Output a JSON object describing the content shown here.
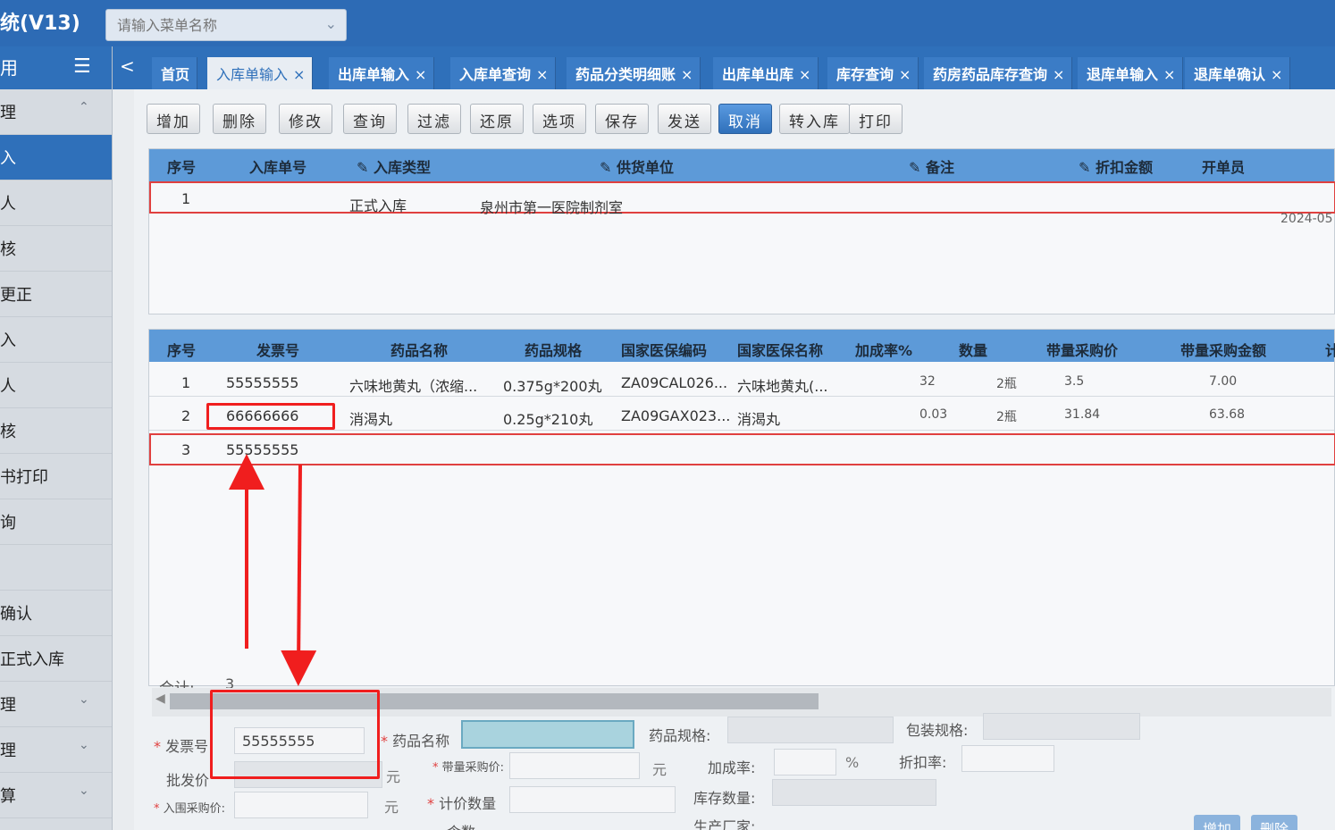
{
  "app": {
    "title": "统(V13)",
    "menu_search_placeholder": "请输入菜单名称"
  },
  "sidebar": {
    "header_label": "用",
    "items": [
      {
        "label": "理",
        "caret": "^",
        "active": false
      },
      {
        "label": "入",
        "active": true
      },
      {
        "label": "人",
        "active": false
      },
      {
        "label": "核",
        "active": false
      },
      {
        "label": "更正",
        "active": false
      },
      {
        "label": "入",
        "active": false
      },
      {
        "label": "人",
        "active": false
      },
      {
        "label": "核",
        "active": false
      },
      {
        "label": "书打印",
        "active": false
      },
      {
        "label": "询",
        "active": false
      },
      {
        "label": "",
        "active": false
      },
      {
        "label": "确认",
        "active": false
      },
      {
        "label": "正式入库",
        "active": false
      },
      {
        "label": "理",
        "caret": "v",
        "active": false
      },
      {
        "label": "理",
        "caret": "v",
        "active": false
      },
      {
        "label": "算",
        "caret": "v",
        "active": false
      }
    ]
  },
  "tabs": [
    {
      "label": "首页",
      "closable": false,
      "active": false
    },
    {
      "label": "入库单输入",
      "closable": true,
      "active": true
    },
    {
      "label": "出库单输入",
      "closable": true,
      "active": false
    },
    {
      "label": "入库单查询",
      "closable": true,
      "active": false
    },
    {
      "label": "药品分类明细账",
      "closable": true,
      "active": false
    },
    {
      "label": "出库单出库",
      "closable": true,
      "active": false
    },
    {
      "label": "库存查询",
      "closable": true,
      "active": false
    },
    {
      "label": "药房药品库存查询",
      "closable": true,
      "active": false
    },
    {
      "label": "退库单输入",
      "closable": true,
      "active": false
    },
    {
      "label": "退库单确认",
      "closable": true,
      "active": false
    }
  ],
  "toolbar": [
    "增加",
    "删除",
    "修改",
    "查询",
    "过滤",
    "还原",
    "选项",
    "保存",
    "发送",
    "取消",
    "转入库",
    "打印"
  ],
  "header_grid": {
    "columns": [
      "序号",
      "入库单号",
      "入库类型",
      "供货单位",
      "备注",
      "折扣金额",
      "开单员"
    ],
    "rows": [
      {
        "seq": "1",
        "no": "",
        "type": "正式入库",
        "supplier": "泉州市第一医院制剂室",
        "remark": "",
        "discount": "",
        "operator": "",
        "date": "2024-05"
      }
    ]
  },
  "detail_grid": {
    "columns": [
      "序号",
      "发票号",
      "药品名称",
      "药品规格",
      "国家医保编码",
      "国家医保名称",
      "加成率%",
      "数量",
      "带量采购价",
      "带量采购金额",
      "计"
    ],
    "rows": [
      {
        "seq": "1",
        "invoice": "55555555",
        "name": "六味地黄丸（浓缩...",
        "spec": "0.375g*200丸",
        "code": "ZA09CAL026...",
        "ins_name": "六味地黄丸(...",
        "rate": "32",
        "qty": "2瓶",
        "price": "3.5",
        "amount": "7.00"
      },
      {
        "seq": "2",
        "invoice": "66666666",
        "name": "消渴丸",
        "spec": "0.25g*210丸",
        "code": "ZA09GAX023...",
        "ins_name": "消渴丸",
        "rate": "0.03",
        "qty": "2瓶",
        "price": "31.84",
        "amount": "63.68"
      },
      {
        "seq": "3",
        "invoice": "55555555",
        "name": "",
        "spec": "",
        "code": "",
        "ins_name": "",
        "rate": "",
        "qty": "",
        "price": "",
        "amount": ""
      }
    ],
    "total_label": "合计:",
    "total_value": "3"
  },
  "form": {
    "invoice_label": "发票号",
    "invoice_value": "55555555",
    "drug_name_label": "药品名称",
    "drug_name_value": "",
    "drug_spec_label": "药品规格:",
    "package_spec_label": "包装规格:",
    "wholesale_label": "批发价",
    "unit_yuan": "元",
    "band_price_label": "带量采购价:",
    "markup_label": "加成率:",
    "percent": "%",
    "discount_rate_label": "折扣率:",
    "purchase_label": "入围采购价:",
    "pricing_qty_label": "计价数量",
    "stock_qty_label": "库存数量:",
    "manufacturer_label": "生产厂家:",
    "qty_label": "含数",
    "add_button": "增加",
    "delete_button": "删除"
  },
  "colors": {
    "header_blue": "#2f70ba",
    "grid_head": "#5d9ad8",
    "selection": "#e0403f",
    "annotation": "#f01e1e"
  }
}
